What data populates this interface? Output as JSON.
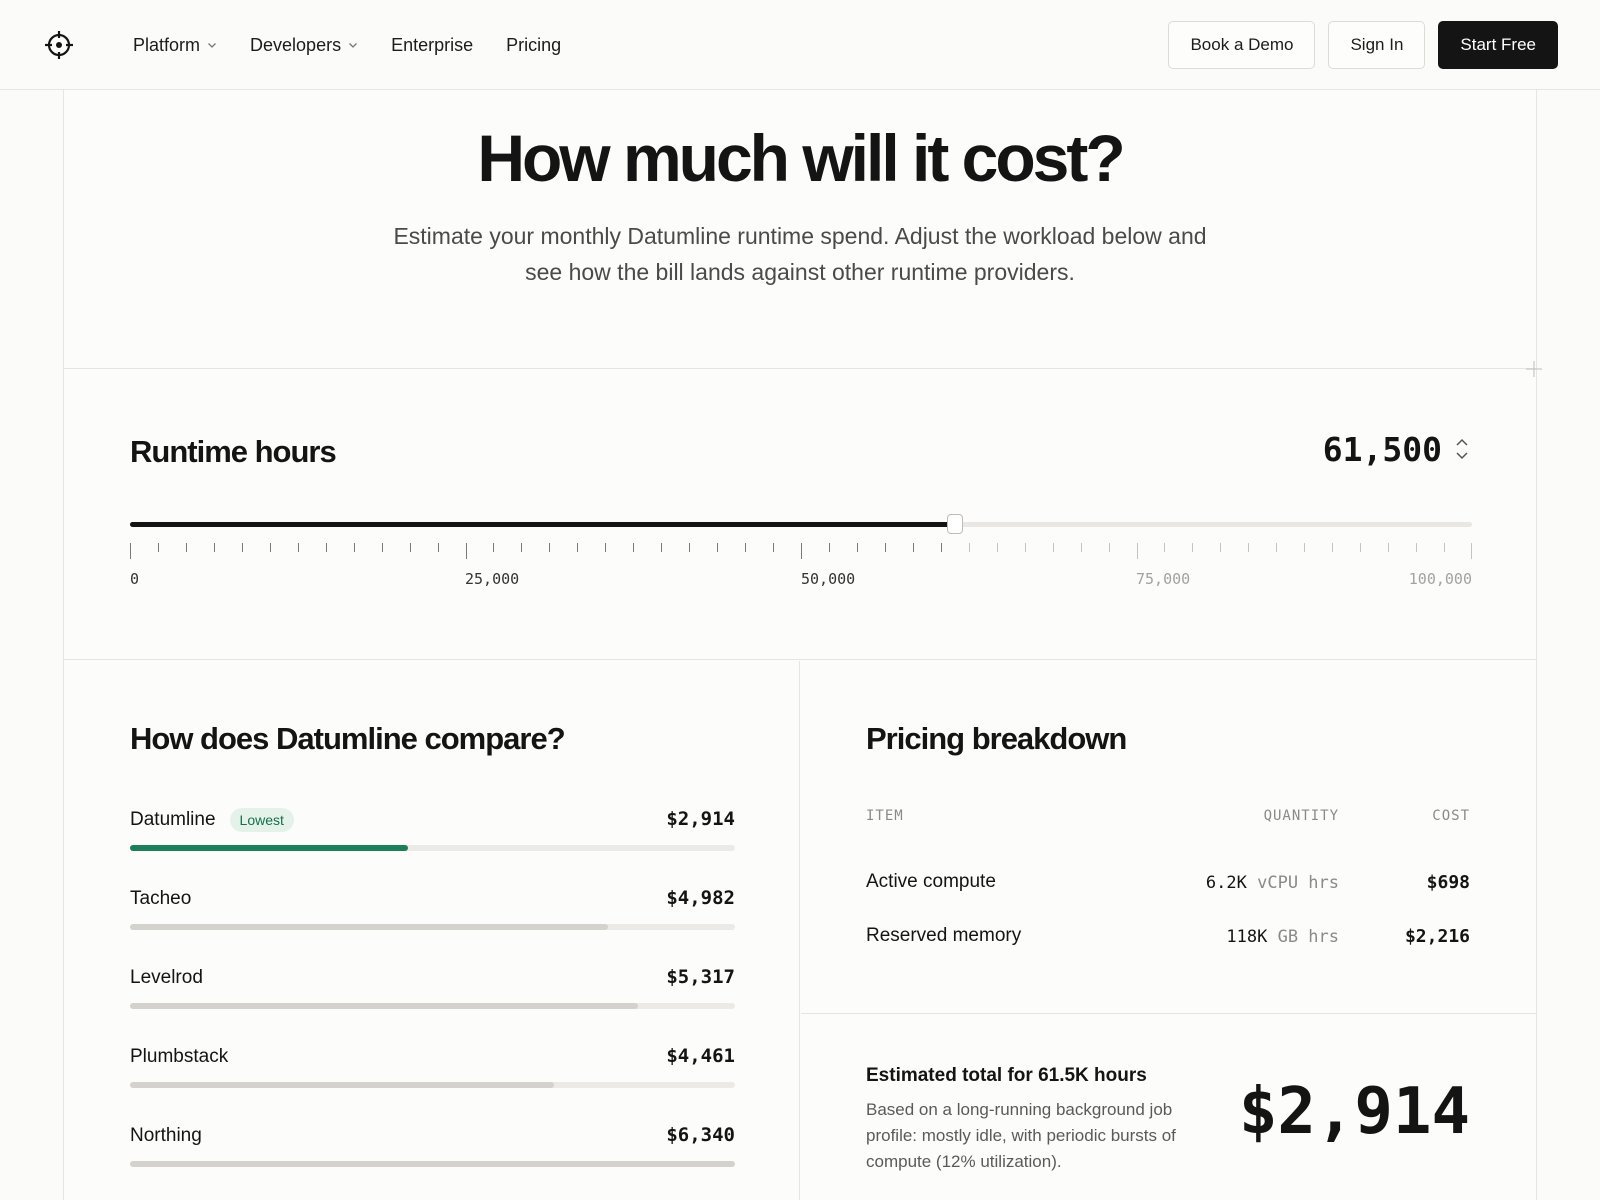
{
  "nav": {
    "links": [
      {
        "label": "Platform",
        "has_dropdown": true
      },
      {
        "label": "Developers",
        "has_dropdown": true
      },
      {
        "label": "Enterprise",
        "has_dropdown": false
      },
      {
        "label": "Pricing",
        "has_dropdown": false
      }
    ],
    "book_demo": "Book a Demo",
    "sign_in": "Sign In",
    "start_free": "Start Free"
  },
  "hero": {
    "title": "How much will it cost?",
    "subtitle": "Estimate your monthly Datumline runtime spend. Adjust the workload below and see how the bill lands against other runtime providers."
  },
  "runtime": {
    "title": "Runtime hours",
    "value_display": "61,500",
    "value": 61500,
    "max": 100000,
    "tick_labels": [
      "0",
      "25,000",
      "50,000",
      "75,000",
      "100,000"
    ]
  },
  "compare": {
    "title": "How does Datumline compare?",
    "max_cost": 6340,
    "providers": [
      {
        "name": "Datumline",
        "badge": "Lowest",
        "cost": "$2,914",
        "amount": 2914,
        "winner": true
      },
      {
        "name": "Tacheo",
        "badge": "",
        "cost": "$4,982",
        "amount": 4982,
        "winner": false
      },
      {
        "name": "Levelrod",
        "badge": "",
        "cost": "$5,317",
        "amount": 5317,
        "winner": false
      },
      {
        "name": "Plumbstack",
        "badge": "",
        "cost": "$4,461",
        "amount": 4461,
        "winner": false
      },
      {
        "name": "Northing",
        "badge": "",
        "cost": "$6,340",
        "amount": 6340,
        "winner": false
      }
    ]
  },
  "breakdown": {
    "title": "Pricing breakdown",
    "headers": {
      "item": "ITEM",
      "quantity": "QUANTITY",
      "cost": "COST"
    },
    "rows": [
      {
        "item": "Active compute",
        "qty": "6.2K",
        "unit": "vCPU hrs",
        "cost": "$698"
      },
      {
        "item": "Reserved memory",
        "qty": "118K",
        "unit": "GB hrs",
        "cost": "$2,216"
      }
    ]
  },
  "total": {
    "label": "Estimated total for 61.5K hours",
    "description": "Based on a long-running background job profile: mostly idle, with periodic bursts of compute (12% utilization).",
    "amount": "$2,914"
  },
  "colors": {
    "accent_green": "#1d7f57",
    "ink": "#141414",
    "badge_bg": "#e4f2ea"
  }
}
